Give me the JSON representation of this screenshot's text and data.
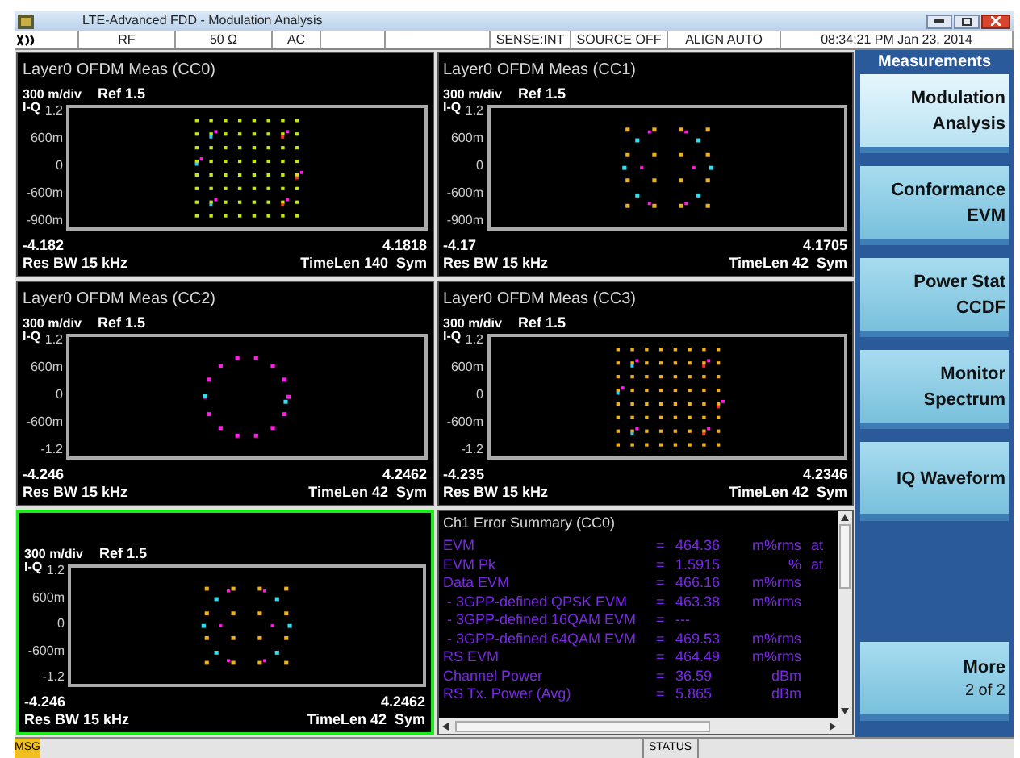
{
  "window": {
    "title": "LTE-Advanced FDD - Modulation Analysis"
  },
  "status_row": [
    "RF",
    "50 Ω",
    "AC",
    "SENSE:INT",
    "SOURCE OFF",
    "ALIGN AUTO",
    "08:34:21 PM Jan 23, 2014"
  ],
  "panels": [
    {
      "title": "Layer0 OFDM Meas (CC0)",
      "scale": "300 m/div",
      "ref": "Ref 1.5",
      "axis": "I-Q",
      "yticks": [
        "1.2",
        "600m",
        "0",
        "-600m",
        "-900m"
      ],
      "xmin": "-4.182",
      "xmax": "4.1818",
      "rbw": "Res BW 15 kHz",
      "timelen": "TimeLen 140  Sym",
      "kind": "qam64",
      "color": "#c8e614",
      "selected": false
    },
    {
      "title": "Layer0 OFDM Meas (CC1)",
      "scale": "300 m/div",
      "ref": "Ref 1.5",
      "axis": "I-Q",
      "yticks": [
        "1.2",
        "600m",
        "0",
        "-600m",
        "-900m"
      ],
      "xmin": "-4.17",
      "xmax": "4.1705",
      "rbw": "Res BW 15 kHz",
      "timelen": "TimeLen 42  Sym",
      "kind": "qam16",
      "color": "#f0b020",
      "selected": false
    },
    {
      "title": "Layer0 OFDM Meas (CC2)",
      "scale": "300 m/div",
      "ref": "Ref 1.5",
      "axis": "I-Q",
      "yticks": [
        "1.2",
        "600m",
        "0",
        "-600m",
        "-1.2"
      ],
      "xmin": "-4.246",
      "xmax": "4.2462",
      "rbw": "Res BW 15 kHz",
      "timelen": "TimeLen 42  Sym",
      "kind": "ring",
      "color": "#ff1ee6",
      "selected": false
    },
    {
      "title": "Layer0 OFDM Meas (CC3)",
      "scale": "300 m/div",
      "ref": "Ref 1.5",
      "axis": "I-Q",
      "yticks": [
        "1.2",
        "600m",
        "0",
        "-600m",
        "-1.2"
      ],
      "xmin": "-4.235",
      "xmax": "4.2346",
      "rbw": "Res BW 15 kHz",
      "timelen": "TimeLen 42  Sym",
      "kind": "qam64",
      "color": "#f0b020",
      "selected": false
    },
    {
      "scale": "300 m/div",
      "ref": "Ref 1.5",
      "axis": "I-Q",
      "yticks": [
        "1.2",
        "600m",
        "0",
        "-600m",
        "-1.2"
      ],
      "xmin": "-4.246",
      "xmax": "4.2462",
      "rbw": "Res BW 15 kHz",
      "timelen": "TimeLen 42  Sym",
      "kind": "qam16",
      "color": "#f0b020",
      "selected": true
    }
  ],
  "error_summary": {
    "title": "Ch1 Error Summary (CC0)",
    "rows": [
      {
        "label": "EVM",
        "eq": "=",
        "value": "464.36",
        "unit": "m%rms",
        "extra": "at"
      },
      {
        "label": "EVM Pk",
        "eq": "=",
        "value": "1.5915",
        "unit": "%",
        "extra": "at"
      },
      {
        "label": "Data EVM",
        "eq": "=",
        "value": "466.16",
        "unit": "m%rms"
      },
      {
        "label": " - 3GPP-defined QPSK EVM",
        "eq": "=",
        "value": "463.38",
        "unit": "m%rms"
      },
      {
        "label": " - 3GPP-defined 16QAM EVM",
        "eq": "=",
        "value": "---"
      },
      {
        "label": " - 3GPP-defined 64QAM EVM",
        "eq": "=",
        "value": "469.53",
        "unit": "m%rms"
      },
      {
        "label": "RS EVM",
        "eq": "=",
        "value": "464.49",
        "unit": "m%rms"
      },
      {
        "label": "Channel Power",
        "eq": "=",
        "value": "36.59",
        "unit": "dBm"
      },
      {
        "label": "RS Tx. Power (Avg)",
        "eq": "=",
        "value": "5.865",
        "unit": "dBm"
      }
    ]
  },
  "softkeys": {
    "title": "Measurements",
    "keys": [
      {
        "lines": [
          "Modulation",
          "Analysis"
        ],
        "selected": true
      },
      {
        "lines": [
          "Conformance",
          "EVM"
        ],
        "selected": false
      },
      {
        "lines": [
          "Power Stat",
          "CCDF"
        ],
        "selected": false
      },
      {
        "lines": [
          "Monitor",
          "Spectrum"
        ],
        "selected": false
      },
      {
        "lines": [
          "IQ Waveform"
        ],
        "selected": false
      },
      {
        "kind": "gap"
      },
      {
        "lines": [
          "More"
        ],
        "sub": "2 of 2",
        "selected": false
      }
    ]
  },
  "bottom_bar": {
    "msg": "MSG",
    "status": "STATUS"
  }
}
